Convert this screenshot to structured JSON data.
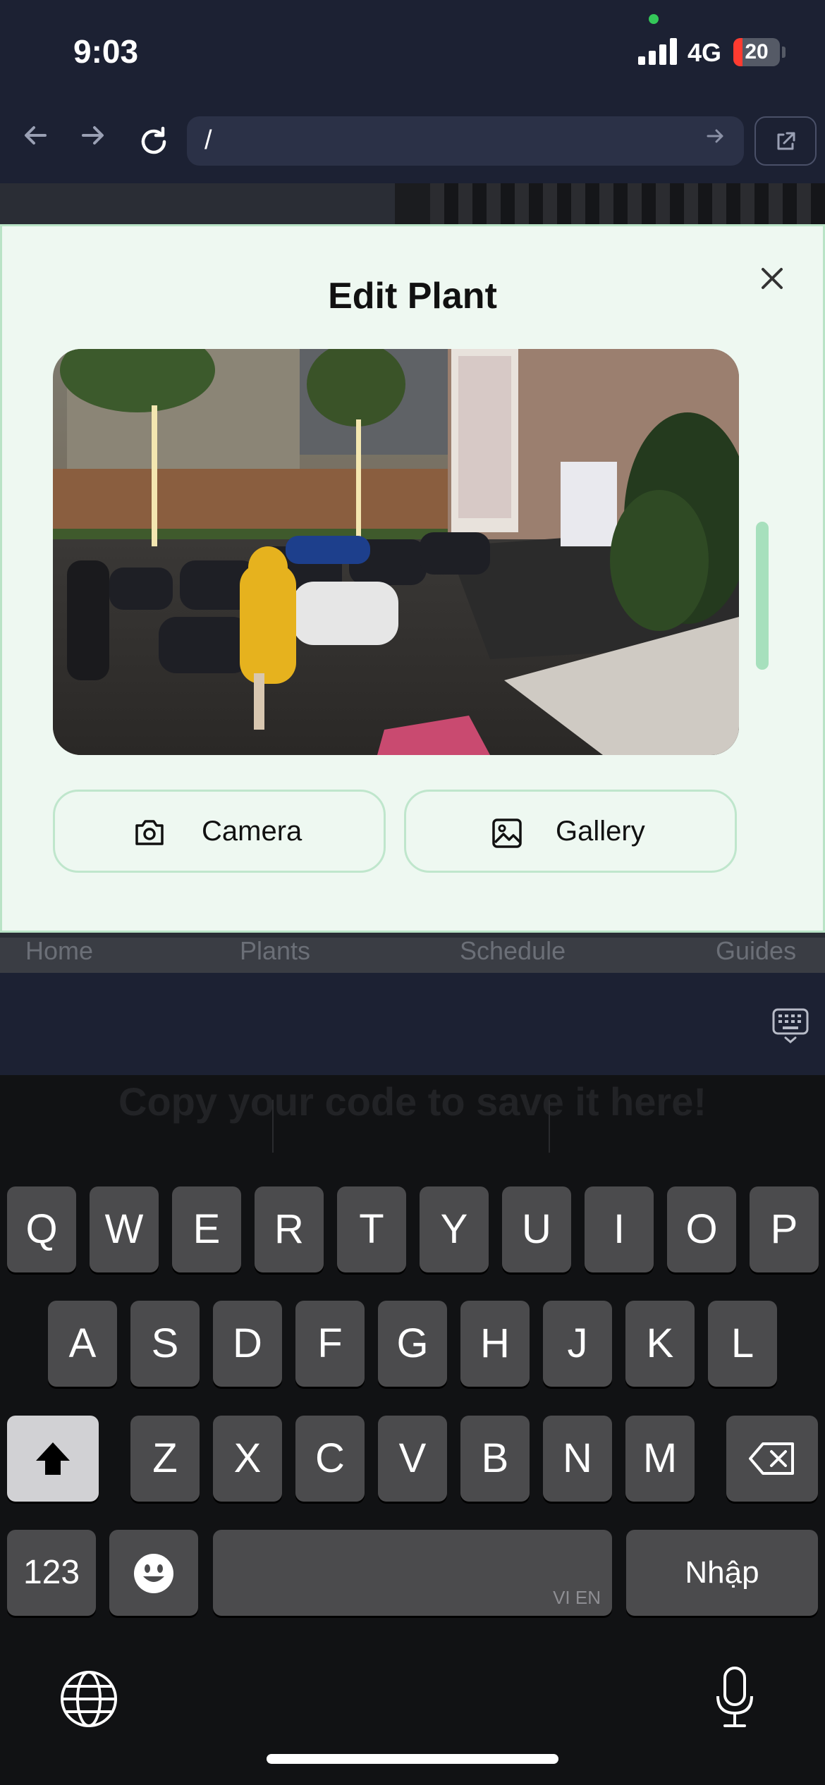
{
  "status": {
    "time": "9:03",
    "network": "4G",
    "battery": "20",
    "battery_level": 0.2
  },
  "browser": {
    "url": "/",
    "back_icon": "arrow-left-icon",
    "forward_icon": "arrow-right-icon",
    "reload_icon": "reload-icon",
    "go_icon": "arrow-right-icon",
    "external_icon": "external-link-icon"
  },
  "background_nav": {
    "items": [
      "Home",
      "Plants",
      "Schedule",
      "Guides"
    ]
  },
  "modal": {
    "title": "Edit Plant",
    "close_icon": "close-icon",
    "camera_label": "Camera",
    "gallery_label": "Gallery"
  },
  "keyboard": {
    "ghost_text": "Copy your code to save it here!",
    "row1": [
      "Q",
      "W",
      "E",
      "R",
      "T",
      "Y",
      "U",
      "I",
      "O",
      "P"
    ],
    "row2": [
      "A",
      "S",
      "D",
      "F",
      "G",
      "H",
      "J",
      "K",
      "L"
    ],
    "row3": [
      "Z",
      "X",
      "C",
      "V",
      "B",
      "N",
      "M"
    ],
    "numbers_label": "123",
    "space_hint": "VI EN",
    "return_label": "Nhập"
  },
  "colors": {
    "accent_green": "#a7e0bd",
    "modal_bg": "#eef8f1"
  }
}
